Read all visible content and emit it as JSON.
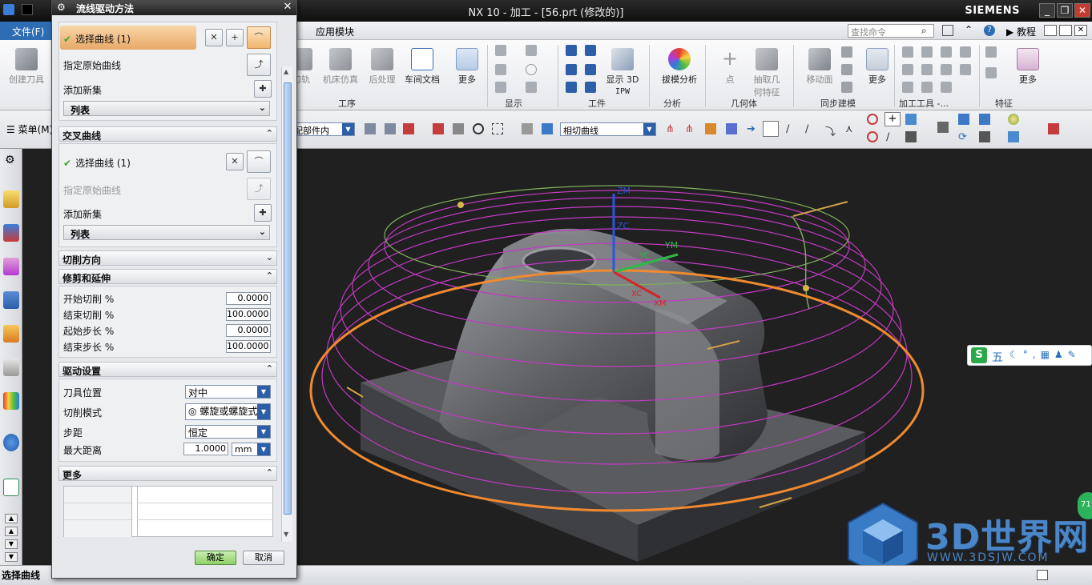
{
  "window": {
    "title": "NX 10 - 加工 - [56.prt (修改的)]",
    "brand": "SIEMENS",
    "controls": [
      "_",
      "❐",
      "✕"
    ]
  },
  "menubar": {
    "file": "文件(F)",
    "app_module": "应用模块",
    "search_placeholder": "查找命令",
    "tutorial": "教程"
  },
  "ribbon": {
    "create_tool": "创建刀具",
    "tool_path": "刀轨",
    "machine_sim": "机床仿真",
    "post_process": "后处理",
    "shop_doc": "车间文档",
    "more": "更多",
    "show_3d_ipw_line1": "显示 3D",
    "show_3d_ipw_line2": "IPW",
    "draft_analysis": "拔模分析",
    "point": "点",
    "extract_geom_line1": "抽取几",
    "extract_geom_line2": "何特征",
    "move_face": "移动面",
    "groups": {
      "operation": "工序",
      "display": "显示",
      "workpiece": "工件",
      "analysis": "分析",
      "geometry": "几何体",
      "sync_modeling": "同步建模",
      "machining_tools": "加工工具 -...",
      "feature": "特征"
    }
  },
  "toolbar": {
    "menu_label": "菜单(M)",
    "scope_combo": "整个装配部件内",
    "snap_combo": "相切曲线"
  },
  "dialog": {
    "title": "流线驱动方法",
    "flow_curves": {
      "select_curve": "选择曲线 (1)",
      "specify_origin_curve": "指定原始曲线",
      "add_new_set": "添加新集",
      "list": "列表"
    },
    "cross_curves": {
      "header": "交叉曲线",
      "select_curve": "选择曲线 (1)",
      "specify_origin_curve": "指定原始曲线",
      "add_new_set": "添加新集",
      "list": "列表"
    },
    "cut_direction": {
      "header": "切削方向"
    },
    "trim_extend": {
      "header": "修剪和延伸",
      "rows": [
        {
          "label": "开始切削 %",
          "value": "0.0000"
        },
        {
          "label": "结束切削 %",
          "value": "100.0000"
        },
        {
          "label": "起始步长 %",
          "value": "0.0000"
        },
        {
          "label": "结束步长 %",
          "value": "100.0000"
        }
      ]
    },
    "drive_settings": {
      "header": "驱动设置",
      "tool_position_label": "刀具位置",
      "tool_position_value": "对中",
      "cut_pattern_label": "切削模式",
      "cut_pattern_value": "螺旋或螺旋式",
      "stepover_label": "步距",
      "stepover_value": "恒定",
      "max_distance_label": "最大距离",
      "max_distance_value": "1.0000",
      "max_distance_unit": "mm"
    },
    "more": {
      "header": "更多"
    },
    "ok": "确定",
    "cancel": "取消"
  },
  "viewport": {
    "axes": {
      "zm": "ZM",
      "zc": "ZC",
      "ym": "YM",
      "yc": "YC",
      "xc": "XC",
      "xm": "XM"
    }
  },
  "ime": {
    "s": "S",
    "wu": "五",
    "rest": "☾°,▦♟✎"
  },
  "badge": "71",
  "watermark": {
    "text": "3D世界网",
    "url": "WWW.3DSJW.COM"
  },
  "statusbar": {
    "prompt": "选择曲线"
  },
  "colors": {
    "accent": "#2e6db3",
    "highlight": "#f2b56e",
    "helix": "#c23ac2",
    "boundary": "#f08a30"
  }
}
